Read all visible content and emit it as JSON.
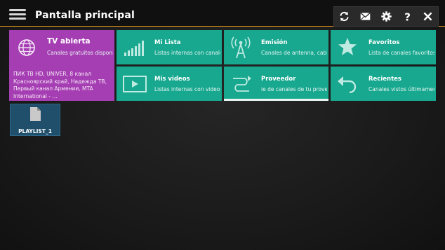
{
  "header": {
    "title": "Pantalla principal",
    "actions": [
      {
        "icon": "refresh-icon"
      },
      {
        "icon": "mail-icon"
      },
      {
        "icon": "gear-icon"
      },
      {
        "icon": "help-icon"
      },
      {
        "icon": "close-icon"
      }
    ]
  },
  "tiles": {
    "tv_abierta": {
      "name": "TV abierta",
      "subtitle": "Canales gratuitos disponib",
      "channels": "ПИК ТВ HD, UNIVER, 8 канал Красноярский край, Надежда ТВ, Первый канал Армении, MTA International - ...",
      "color": "#a63eb3"
    },
    "mi_lista": {
      "name": "Mi Lista",
      "subtitle": "Listas internas con canales"
    },
    "emision": {
      "name": "Emisión",
      "subtitle": "Canales de antenna, cable"
    },
    "favoritos": {
      "name": "Favoritos",
      "subtitle": "Lista de canales favoritos"
    },
    "mis_videos": {
      "name": "Mis videos",
      "subtitle": "Listas internas con videos"
    },
    "proveedor": {
      "name": "Proveedor",
      "subtitle": "ie de canales de tu provee"
    },
    "recientes": {
      "name": "Recientes",
      "subtitle": "Canales vistos últimamente"
    }
  },
  "playlist": {
    "label": "PLAYLIST_1"
  },
  "colors": {
    "accent": "#e0961c",
    "teal": "#17a88f",
    "purple": "#a63eb3",
    "playlist": "#1f4f6b"
  }
}
